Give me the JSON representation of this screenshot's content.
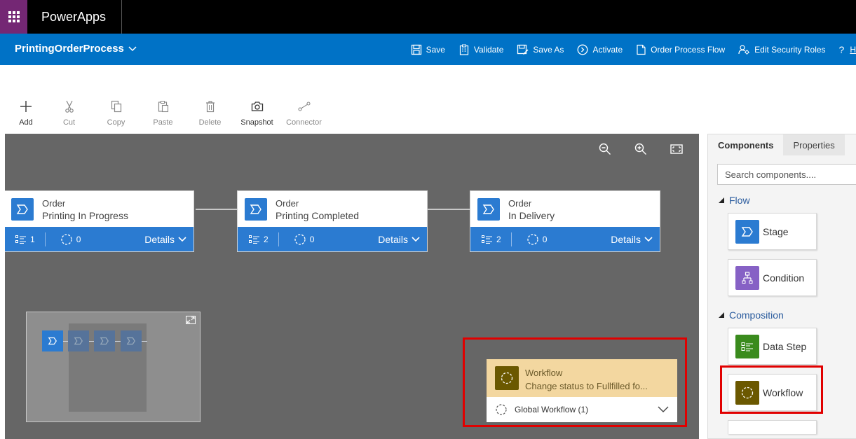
{
  "app": {
    "title": "PowerApps"
  },
  "header": {
    "process_name": "PrintingOrderProcess",
    "commands": [
      {
        "label": "Save",
        "icon": "save-icon"
      },
      {
        "label": "Validate",
        "icon": "validate-icon"
      },
      {
        "label": "Save As",
        "icon": "save-as-icon"
      },
      {
        "label": "Activate",
        "icon": "activate-icon"
      },
      {
        "label": "Order Process Flow",
        "icon": "order-flow-icon"
      },
      {
        "label": "Edit Security Roles",
        "icon": "security-roles-icon"
      },
      {
        "label": "?",
        "icon": "help-icon"
      },
      {
        "label": "H",
        "icon": ""
      }
    ]
  },
  "toolbar": {
    "items": [
      {
        "label": "Add",
        "icon": "plus-icon",
        "enabled": true
      },
      {
        "label": "Cut",
        "icon": "scissors-icon",
        "enabled": false
      },
      {
        "label": "Copy",
        "icon": "copy-icon",
        "enabled": false
      },
      {
        "label": "Paste",
        "icon": "paste-icon",
        "enabled": false
      },
      {
        "label": "Delete",
        "icon": "trash-icon",
        "enabled": false
      },
      {
        "label": "Snapshot",
        "icon": "camera-icon",
        "enabled": true
      },
      {
        "label": "Connector",
        "icon": "connector-icon",
        "enabled": false
      }
    ]
  },
  "canvas": {
    "stages": [
      {
        "title": "Order",
        "subtitle": "Printing In Progress",
        "steps": "1",
        "workflows": "0",
        "details": "Details"
      },
      {
        "title": "Order",
        "subtitle": "Printing Completed",
        "steps": "2",
        "workflows": "0",
        "details": "Details"
      },
      {
        "title": "Order",
        "subtitle": "In Delivery",
        "steps": "2",
        "workflows": "0",
        "details": "Details"
      }
    ],
    "workflow_card": {
      "title": "Workflow",
      "subtitle": "Change status to Fullfilled fo...",
      "footer": "Global Workflow (1)"
    }
  },
  "panel": {
    "tabs": [
      "Components",
      "Properties"
    ],
    "search_placeholder": "Search components....",
    "sections": [
      {
        "label": "Flow",
        "items": [
          {
            "label": "Stage",
            "color": "#2b7bd1"
          },
          {
            "label": "Condition",
            "color": "#8661c5"
          }
        ]
      },
      {
        "label": "Composition",
        "items": [
          {
            "label": "Data Step",
            "color": "#3a8b1d"
          },
          {
            "label": "Workflow",
            "color": "#6b5800"
          }
        ]
      }
    ]
  },
  "colors": {
    "brand_bar": "#0072c6",
    "waffle": "#742774",
    "stage": "#2b7bd1",
    "highlight": "#e10000"
  }
}
